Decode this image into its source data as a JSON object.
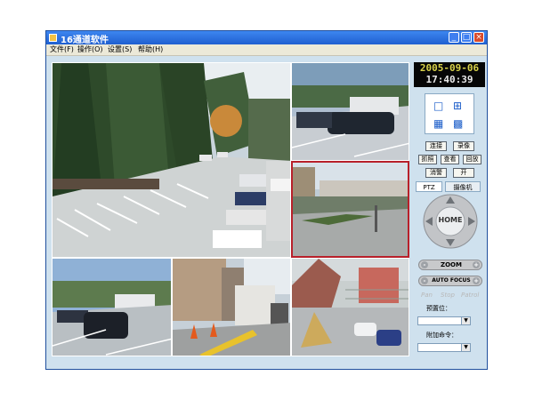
{
  "window": {
    "title": "16通道软件"
  },
  "menu": [
    "文件(F)",
    "操作(O)",
    "设置(S)",
    "帮助(H)"
  ],
  "clock": {
    "date": "2005-09-06",
    "time": "17:40:39"
  },
  "layout_buttons": [
    "1x1 layout",
    "2x2 layout",
    "3x3 layout",
    "4x4 layout"
  ],
  "buttons": {
    "connect": "连接",
    "record": "录像",
    "snapshot": "抓照",
    "view": "查看",
    "playback": "回放",
    "alarm_clear": "消警",
    "open": "开"
  },
  "tabs": {
    "ptz": "PTZ",
    "camera": "摄像机"
  },
  "dpad": {
    "center": "HOME"
  },
  "zoom": {
    "label": "ZOOM",
    "minus": "-",
    "plus": "+"
  },
  "focus": {
    "label": "AUTO FOCUS",
    "minus": "-",
    "plus": "+"
  },
  "patrol": [
    "Pan",
    "Stop",
    "Patrol"
  ],
  "preset": {
    "label": "预置位：",
    "value": ""
  },
  "extra_cmd": {
    "label": "附加命令：",
    "value": ""
  },
  "colors": {
    "title_bar": "#2b6fd6",
    "client_bg": "#cfe1ee",
    "active_border": "#b8202a",
    "clock_digits": "#d8d24a"
  }
}
